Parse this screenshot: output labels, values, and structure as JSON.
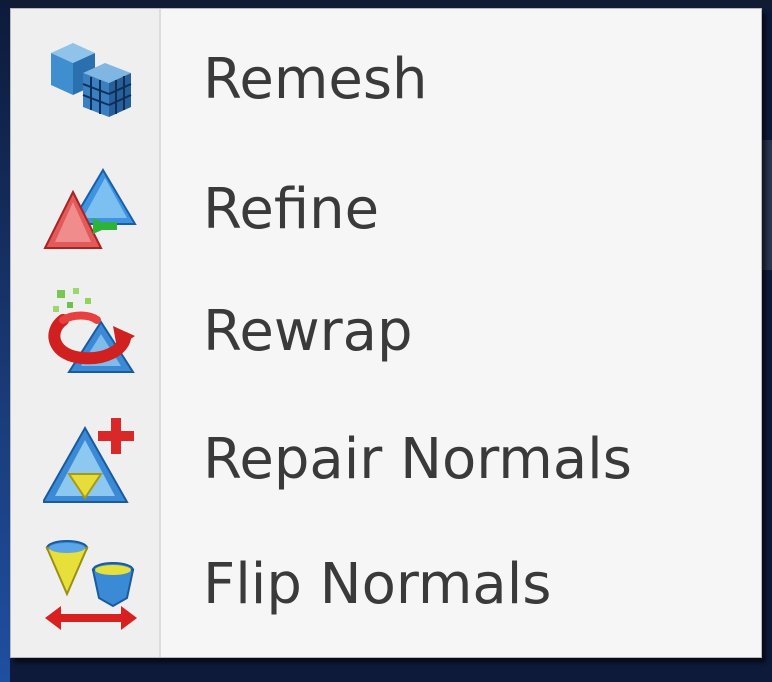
{
  "menu": {
    "items": [
      {
        "label": "Remesh",
        "icon": "remesh-icon"
      },
      {
        "label": "Refine",
        "icon": "refine-icon"
      },
      {
        "label": "Rewrap",
        "icon": "rewrap-icon"
      },
      {
        "label": "Repair Normals",
        "icon": "repair-normals-icon"
      },
      {
        "label": "Flip Normals",
        "icon": "flip-normals-icon"
      }
    ]
  },
  "colors": {
    "menu_background": "#f6f6f6",
    "gutter_background": "#efefef",
    "text": "#3a3a3a",
    "app_background": "#0d1a3a"
  }
}
